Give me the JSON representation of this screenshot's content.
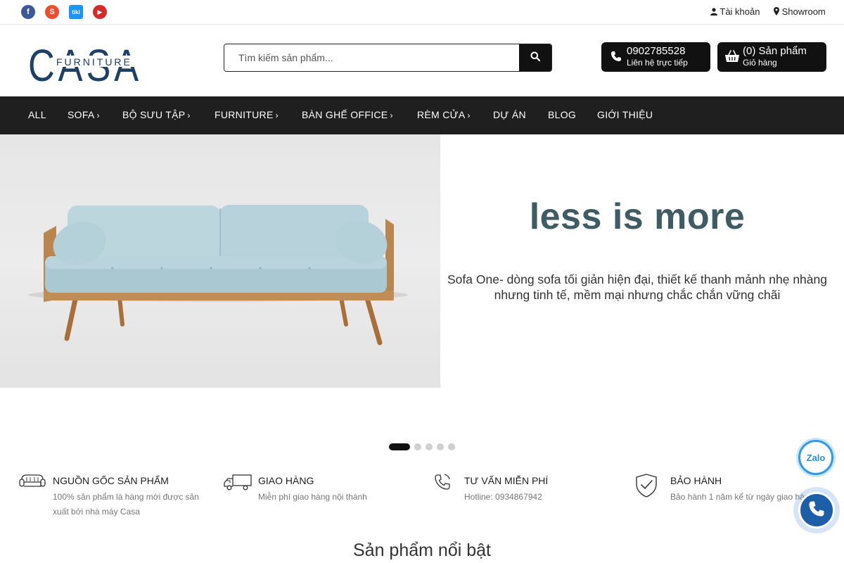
{
  "topbar": {
    "social": [
      {
        "name": "facebook-icon",
        "glyph": "f",
        "color": "#3b5998"
      },
      {
        "name": "shopee-icon",
        "glyph": "S",
        "color": "#ee4d2d"
      },
      {
        "name": "tiki-icon",
        "glyph": "tiki",
        "color": "#1a94ff"
      },
      {
        "name": "youtube-icon",
        "glyph": "▶",
        "color": "#d62b2b"
      }
    ],
    "account_label": "Tài khoản",
    "showroom_label": "Showroom"
  },
  "header": {
    "logo_text": "CASA",
    "logo_subtext": "FURNITURE",
    "logo_color": "#1e3f66",
    "search_placeholder": "Tìm kiếm sản phẩm...",
    "hotline_number": "0902785528",
    "hotline_label": "Liên hệ trực tiếp",
    "cart_count_label": "(0) Sản phẩm",
    "cart_label": "Giỏ hàng"
  },
  "nav": {
    "items": [
      {
        "label": "ALL",
        "has_submenu": false
      },
      {
        "label": "SOFA",
        "has_submenu": true
      },
      {
        "label": "BỘ SƯU TẬP",
        "has_submenu": true
      },
      {
        "label": "FURNITURE",
        "has_submenu": true
      },
      {
        "label": "BÀN GHẾ OFFICE",
        "has_submenu": true
      },
      {
        "label": "RÈM CỬA",
        "has_submenu": true
      },
      {
        "label": "DỰ ÁN",
        "has_submenu": false
      },
      {
        "label": "BLOG",
        "has_submenu": false
      },
      {
        "label": "GIỚI THIỆU",
        "has_submenu": false
      }
    ]
  },
  "hero": {
    "title": "less is more",
    "subtitle_line1": "Sofa One- dòng sofa tối giản hiện đại, thiết kế thanh mảnh nhẹ nhàng",
    "subtitle_line2": "nhưng tinh tế, mềm mại nhưng chắc chắn vững chãi",
    "slide_count": 5,
    "active_slide": 1,
    "title_color": "#3f5b63"
  },
  "features": [
    {
      "icon": "sofa-icon",
      "title": "NGUỒN GỐC SẢN PHẨM",
      "desc": "100% sản phẩm là hàng mới được sản xuất bởi nhà máy Casa"
    },
    {
      "icon": "truck-icon",
      "title": "GIAO HÀNG",
      "desc": "Miễn phí giao hàng nội thành"
    },
    {
      "icon": "phone-icon",
      "title": "TƯ VẤN MIỄN PHÍ",
      "desc": "Hotline: 0934867942"
    },
    {
      "icon": "shield-check-icon",
      "title": "BẢO HÀNH",
      "desc": "Bảo hành 1 năm kể từ ngày giao hàng"
    }
  ],
  "section_title": "Sản phẩm nổi bật",
  "floating": {
    "zalo_label": "Zalo"
  }
}
